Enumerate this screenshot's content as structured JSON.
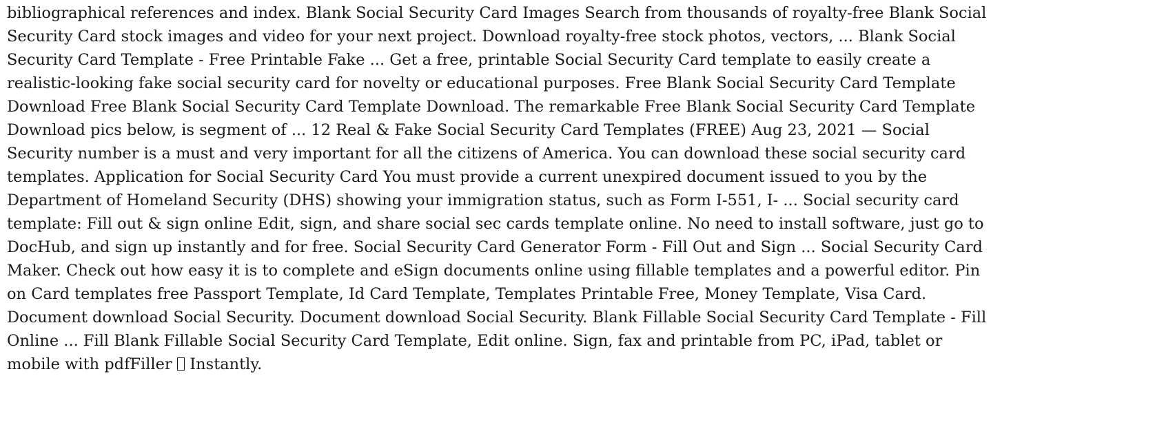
{
  "document": {
    "lines": [
      "bibliographical references and index. Blank Social Security Card Images Search from thousands of royalty-free Blank Social",
      "Security Card stock images and video for your next project. Download royalty-free stock photos, vectors, ... Blank Social",
      "Security Card Template - Free Printable Fake ... Get a free, printable Social Security Card template to easily create a",
      "realistic-looking fake social security card for novelty or educational purposes. Free Blank Social Security Card Template",
      "Download Free Blank Social Security Card Template Download. The remarkable Free Blank Social Security Card Template",
      "Download pics below, is segment of ... 12 Real & Fake Social Security Card Templates (FREE) Aug 23, 2021 — Social",
      "Security number is a must and very important for all the citizens of America. You can download these social security card",
      "templates. Application for Social Security Card You must provide a current unexpired document issued to you by the",
      "Department of Homeland Security (DHS) showing your immigration status, such as Form I-551, I- ... Social security card",
      "template: Fill out & sign online Edit, sign, and share social sec cards template online. No need to install software, just go to",
      "DocHub, and sign up instantly and for free. Social Security Card Generator Form - Fill Out and Sign ... Social Security Card",
      "Maker. Check out how easy it is to complete and eSign documents online using fillable templates and a powerful editor. Pin",
      "on Card templates free Passport Template, Id Card Template, Templates Printable Free, Money Template, Visa Card.",
      "Document download Social Security. Document download Social Security. Blank Fillable Social Security Card Template - Fill",
      "Online ... Fill Blank Fillable Social Security Card Template, Edit online. Sign, fax and printable from PC, iPad, tablet or"
    ],
    "last_line_before": "mobile with pdfFiller",
    "last_line_after": "Instantly."
  }
}
